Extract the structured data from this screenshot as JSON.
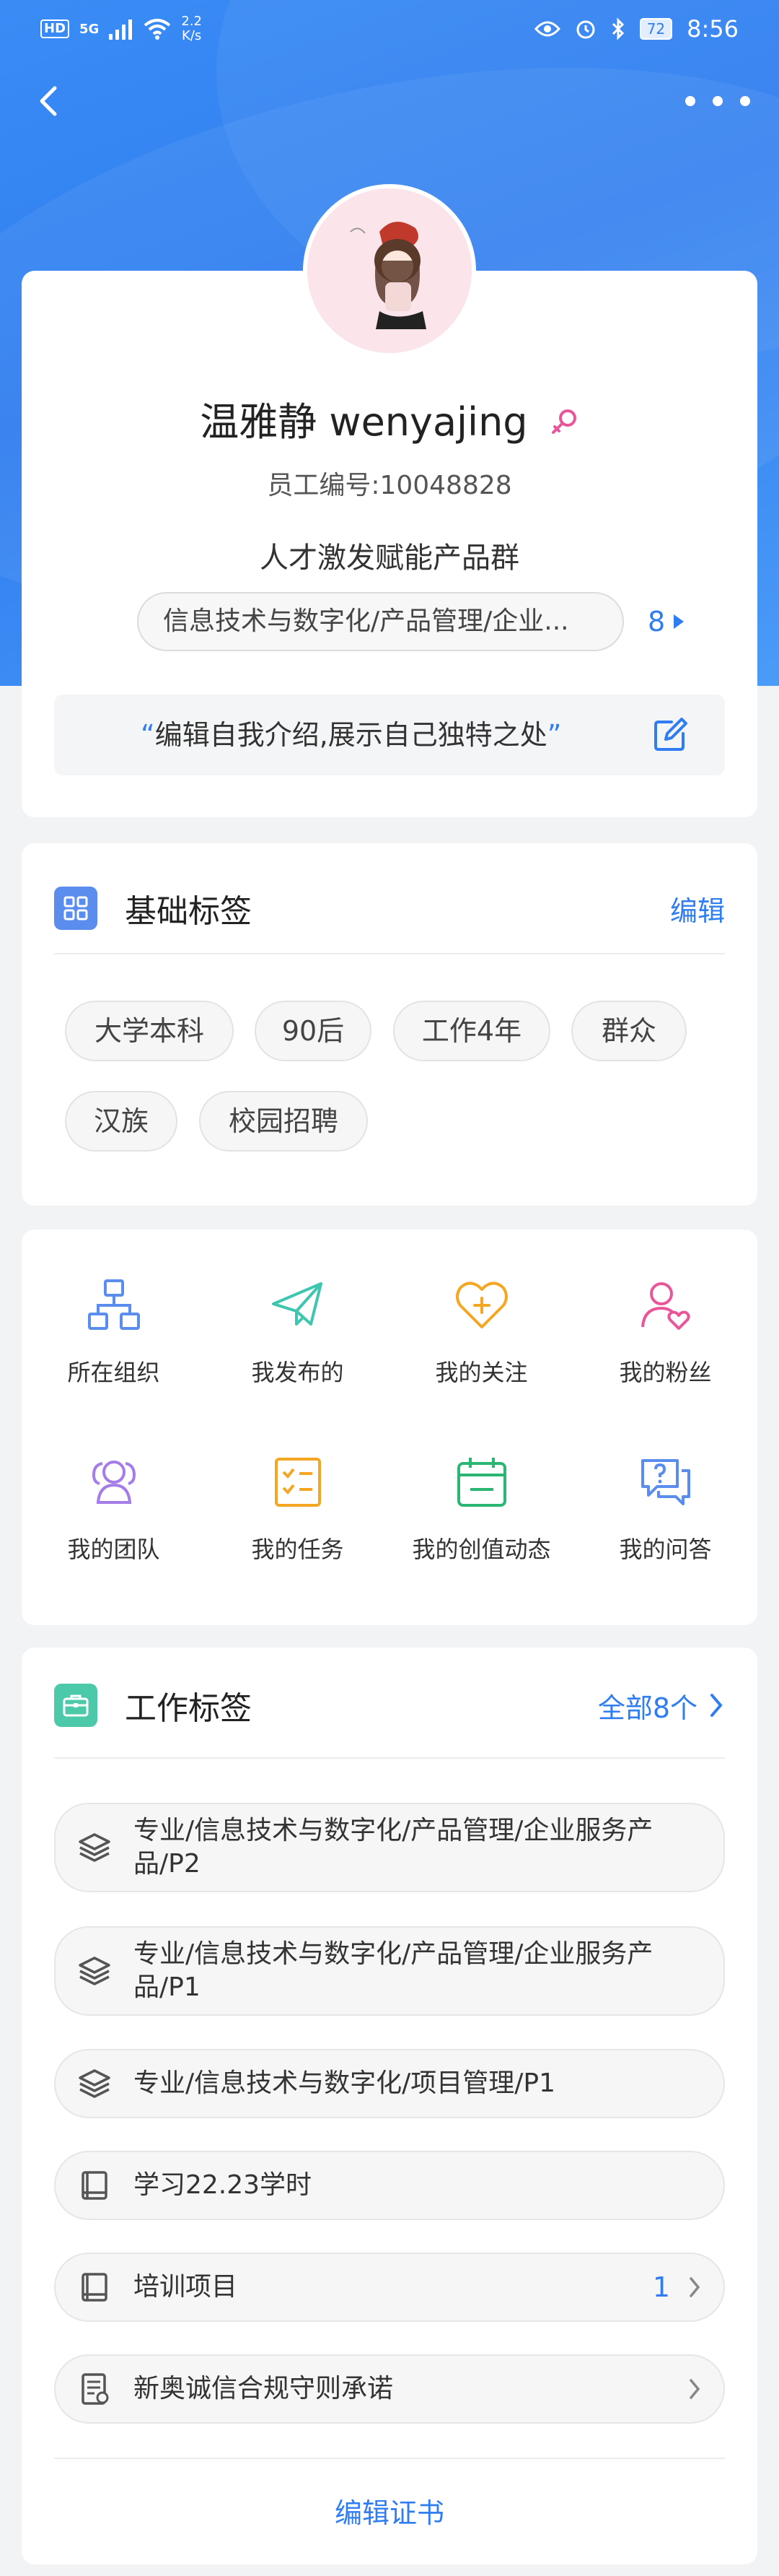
{
  "status_bar": {
    "hd": "HD",
    "signal_gen": "5G",
    "net_speed_value": "2.2",
    "net_speed_unit": "K/s",
    "battery": "72",
    "time": "8:56"
  },
  "profile": {
    "name": "温雅静 wenyajing",
    "employee_no": "员工编号:10048828",
    "department": "人才激发赋能产品群",
    "dept_chip": "信息技术与数字化/产品管理/企业...",
    "dept_count": "8",
    "intro_open_quote": "“",
    "intro_text": "编辑自我介绍,展示自己独特之处",
    "intro_close_quote": "”"
  },
  "basic_tags": {
    "title": "基础标签",
    "action": "编辑",
    "tags": [
      "大学本科",
      "90后",
      "工作4年",
      "群众",
      "汉族",
      "校园招聘"
    ]
  },
  "grid": {
    "items": [
      {
        "label": "所在组织",
        "icon": "org-icon"
      },
      {
        "label": "我发布的",
        "icon": "paper-plane-icon"
      },
      {
        "label": "我的关注",
        "icon": "heart-plus-icon"
      },
      {
        "label": "我的粉丝",
        "icon": "fans-icon"
      },
      {
        "label": "我的团队",
        "icon": "team-icon"
      },
      {
        "label": "我的任务",
        "icon": "task-icon"
      },
      {
        "label": "我的创值动态",
        "icon": "calendar-icon"
      },
      {
        "label": "我的问答",
        "icon": "qa-icon"
      }
    ]
  },
  "work_tags": {
    "title": "工作标签",
    "action": "全部8个",
    "rows": [
      {
        "text": "专业/信息技术与数字化/产品管理/企业服务产品/P2",
        "icon": "layers-icon"
      },
      {
        "text": "专业/信息技术与数字化/产品管理/企业服务产品/P1",
        "icon": "layers-icon"
      },
      {
        "text": "专业/信息技术与数字化/项目管理/P1",
        "icon": "layers-icon"
      },
      {
        "text": "学习22.23学时",
        "icon": "book-icon"
      },
      {
        "text": "培训项目",
        "icon": "book-icon",
        "count": "1"
      },
      {
        "text": "新奥诚信合规守则承诺",
        "icon": "document-icon"
      }
    ],
    "edit_certificate": "编辑证书"
  },
  "colors": {
    "accent": "#2f7df0",
    "hero_blue": "#3a8cf5",
    "female_pink": "#e9579a"
  }
}
